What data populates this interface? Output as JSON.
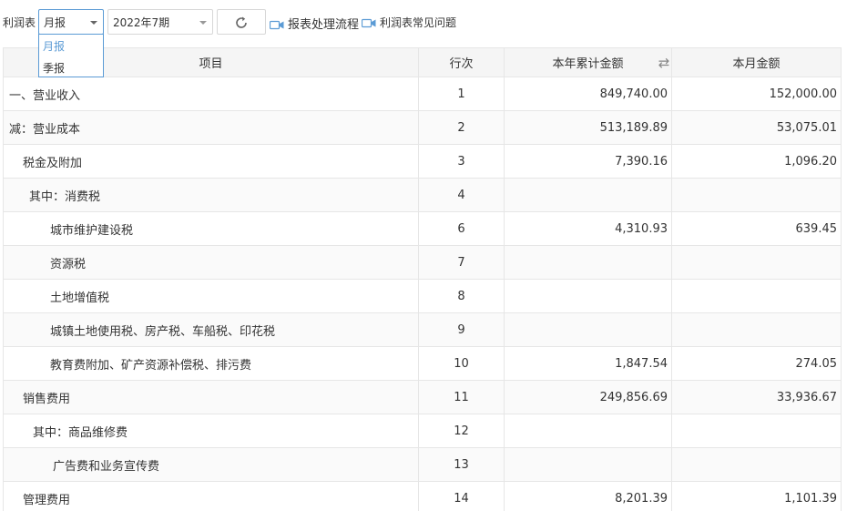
{
  "toolbar": {
    "report_label": "利润表",
    "period_value": "月报",
    "date_value": "2022年7期",
    "flow_link": "报表处理流程",
    "faq_link": "利润表常见问题"
  },
  "dropdown": {
    "options": [
      "月报",
      "季报"
    ],
    "selected": "月报"
  },
  "colors": {
    "accent": "#5b9bd5",
    "border": "#e6e6e6",
    "header_bg": "#f5f5f5"
  },
  "table": {
    "headers": {
      "item": "项目",
      "row": "行次",
      "ytd": "本年累计金额",
      "month": "本月金额"
    },
    "rows": [
      {
        "item": "一、营业收入",
        "row": "1",
        "ytd": "849,740.00",
        "month": "152,000.00"
      },
      {
        "item": "减：营业成本",
        "row": "2",
        "ytd": "513,189.89",
        "month": "53,075.01"
      },
      {
        "item": "税金及附加",
        "row": "3",
        "ytd": "7,390.16",
        "month": "1,096.20"
      },
      {
        "item": "其中：消费税",
        "row": "4",
        "ytd": "",
        "month": ""
      },
      {
        "item": "城市维护建设税",
        "row": "6",
        "ytd": "4,310.93",
        "month": "639.45"
      },
      {
        "item": "资源税",
        "row": "7",
        "ytd": "",
        "month": ""
      },
      {
        "item": "土地增值税",
        "row": "8",
        "ytd": "",
        "month": ""
      },
      {
        "item": "城镇土地使用税、房产税、车船税、印花税",
        "row": "9",
        "ytd": "",
        "month": ""
      },
      {
        "item": "教育费附加、矿产资源补偿税、排污费",
        "row": "10",
        "ytd": "1,847.54",
        "month": "274.05"
      },
      {
        "item": "销售费用",
        "row": "11",
        "ytd": "249,856.69",
        "month": "33,936.67"
      },
      {
        "item": "其中：商品维修费",
        "row": "12",
        "ytd": "",
        "month": ""
      },
      {
        "item": "广告费和业务宣传费",
        "row": "13",
        "ytd": "",
        "month": ""
      },
      {
        "item": "管理费用",
        "row": "14",
        "ytd": "8,201.39",
        "month": "1,101.39"
      }
    ]
  }
}
